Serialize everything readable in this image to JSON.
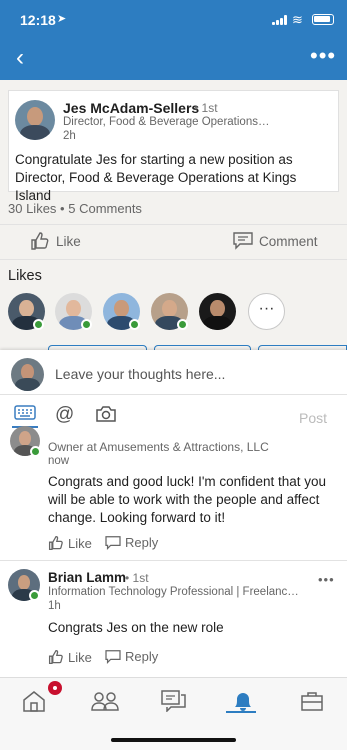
{
  "status": {
    "time": "12:18"
  },
  "post": {
    "author": "Jes McAdam-Sellers",
    "degree": "• 1st",
    "headline": "Director, Food & Beverage Operations…",
    "age": "2h",
    "text": "Congratulate Jes for starting a new position as Director, Food & Beverage Operations at Kings Island"
  },
  "stats": {
    "likes": "30 Likes",
    "separator": "•",
    "comments": "5 Comments"
  },
  "actions": {
    "like": "Like",
    "comment": "Comment"
  },
  "likes_section": {
    "title": "Likes",
    "more": "···"
  },
  "composer": {
    "placeholder": "Leave your thoughts here...",
    "post": "Post"
  },
  "comments": [
    {
      "headline": "Owner at Amusements & Attractions, LLC",
      "age": "now",
      "text": "Congrats and good luck! I'm confident that you will be able to work with the people and affect change. Looking forward to it!",
      "like": "Like",
      "reply": "Reply"
    },
    {
      "author": "Brian Lamm",
      "degree": "• 1st",
      "headline": "Information Technology Professional | Freelanc…",
      "age": "1h",
      "text": "Congrats Jes on the new role",
      "like": "Like",
      "reply": "Reply"
    }
  ],
  "colors": {
    "brand": "#2d7dc1",
    "online": "#3a9b3a",
    "badge": "#c8102e"
  }
}
